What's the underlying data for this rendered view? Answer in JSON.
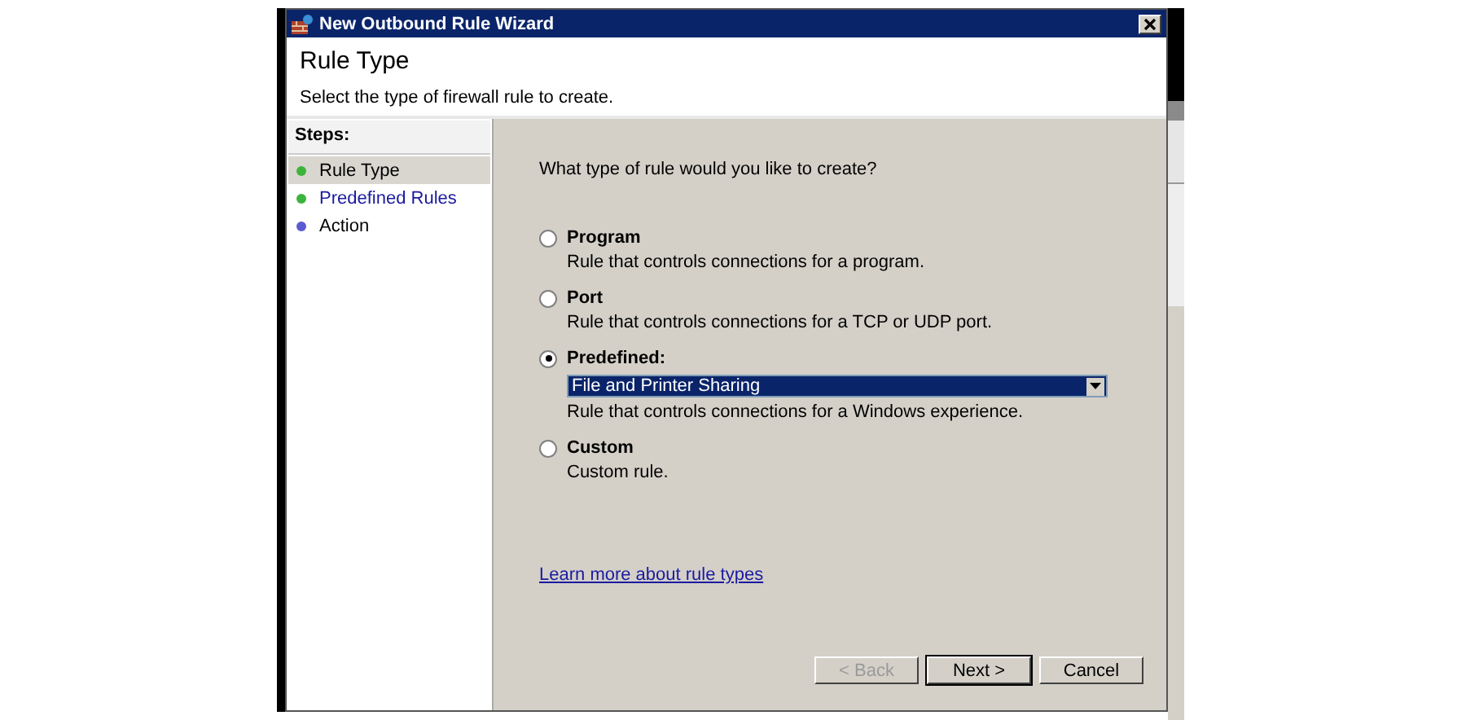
{
  "window": {
    "title": "New Outbound Rule Wizard"
  },
  "header": {
    "title": "Rule Type",
    "subtitle": "Select the type of firewall rule to create."
  },
  "steps": {
    "title": "Steps:",
    "items": [
      {
        "label": "Rule Type",
        "selected": true,
        "link": false,
        "color": "#3cb43c"
      },
      {
        "label": "Predefined Rules",
        "selected": false,
        "link": true,
        "color": "#3cb43c"
      },
      {
        "label": "Action",
        "selected": false,
        "link": false,
        "color": "#5a5ad2"
      }
    ]
  },
  "question": "What type of rule would you like to create?",
  "options": [
    {
      "label": "Program",
      "selected": false,
      "description": "Rule that controls connections for a program."
    },
    {
      "label": "Port",
      "selected": false,
      "description": "Rule that controls connections for a TCP or UDP port."
    },
    {
      "label": "Predefined:",
      "selected": true,
      "dropdown": {
        "value": "File and Printer Sharing"
      },
      "description": "Rule that controls connections for a Windows experience."
    },
    {
      "label": "Custom",
      "selected": false,
      "description": "Custom rule."
    }
  ],
  "link": "Learn more about rule types",
  "buttons": [
    {
      "label": "< Back",
      "disabled": true,
      "default": false
    },
    {
      "label": "Next >",
      "disabled": false,
      "default": true
    },
    {
      "label": "Cancel",
      "disabled": false,
      "default": false
    }
  ]
}
